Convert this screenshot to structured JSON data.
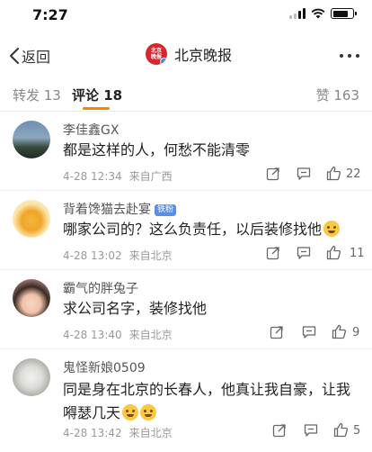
{
  "status": {
    "time": "7:27"
  },
  "nav": {
    "back_label": "返回",
    "title": "北京晚报",
    "logo_text": "北京晚报"
  },
  "tabs": {
    "repost": "转发 13",
    "comment": "评论 18",
    "like": "赞 163"
  },
  "comments": [
    {
      "user": "李佳鑫GX",
      "badge": "",
      "text": "都是这样的人，何愁不能清零",
      "date": "4-28 12:34",
      "location": "来自广西",
      "likes": "22"
    },
    {
      "user": "背着馋猫去赴宴",
      "badge": "铁粉",
      "text": "哪家公司的？这么负责任，以后装修找他",
      "date": "4-28 13:02",
      "location": "来自北京",
      "likes": "11"
    },
    {
      "user": "霸气的胖兔子",
      "badge": "",
      "text": "求公司名字，装修找他",
      "date": "4-28 13:40",
      "location": "来自北京",
      "likes": "9"
    },
    {
      "user": "鬼怪新娘0509",
      "badge": "",
      "text": "同是身在北京的长春人，他真让我自豪，让我嘚瑟几天",
      "date": "4-28 13:42",
      "location": "来自北京",
      "likes": "5"
    }
  ],
  "icons": {
    "back": "chevron-left-icon",
    "more": "more-dots-icon",
    "share": "share-icon",
    "reply": "comment-icon",
    "like": "thumbs-up-icon"
  },
  "colors": {
    "accent": "#ff8200",
    "logo": "#d8262f",
    "verify": "#2a90d9"
  }
}
